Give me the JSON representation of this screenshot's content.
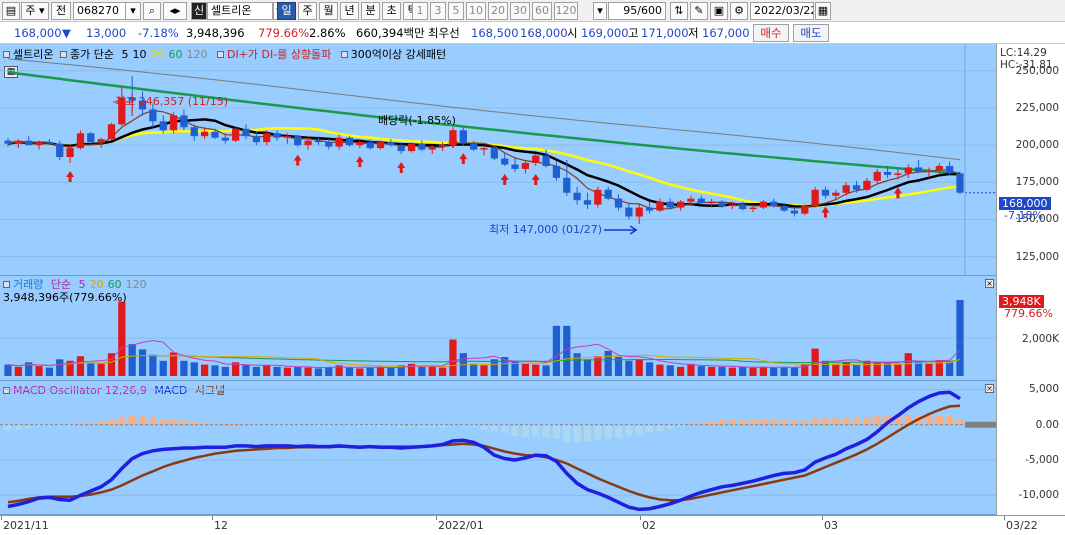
{
  "toolbar": {
    "mode": "주",
    "prev": "전",
    "code": "068270",
    "flag": "신",
    "name": "셀트리온",
    "periods": [
      "일",
      "주",
      "월",
      "년",
      "분",
      "초",
      "틱"
    ],
    "active_period": "일",
    "minutes": [
      "1",
      "3",
      "5",
      "10",
      "20",
      "30",
      "60",
      "120"
    ],
    "count": "95/600",
    "date": "2022/03/22"
  },
  "price_info": {
    "price": "168,000",
    "direction": "▼",
    "change": "13,000",
    "rate": "-7.18%",
    "volume": "3,948,396",
    "vol_ratio": "779.66%",
    "turnover_rate": "2.86%",
    "amount": "660,394백만",
    "best_label": "최우선",
    "best_ask": "168,500",
    "best_bid": "168,000",
    "open_label": "시",
    "open": "169,000",
    "high_label": "고",
    "high": "171,000",
    "low_label": "저",
    "low": "167,000",
    "buy": "매수",
    "sell": "매도"
  },
  "price_panel": {
    "legend_name": "셀트리온",
    "legend_close": "종가 단순",
    "ma_labels": [
      "5",
      "10",
      "20",
      "60",
      "120"
    ],
    "ma_colors": [
      "#000000",
      "#000000",
      "#ffff00",
      "#1a9a4a",
      "#888888"
    ],
    "signal": "DI+가 DI-를 상향돌파",
    "pattern": "300억이상 강세패턴",
    "lc": "LC:14.29",
    "hc": "HC:-31.81",
    "high_note": "최고 246,357 (11/15)",
    "low_note": "최저 147,000 (01/27)",
    "dividend_note": "배당락(-1.85%)",
    "y_ticks": [
      "250,000",
      "225,000",
      "200,000",
      "175,000",
      "150,000",
      "125,000"
    ],
    "current_price": "168,000",
    "current_rate": "-7.18%"
  },
  "volume_panel": {
    "legend": "거래량",
    "ma_label": "단순",
    "ma_periods": [
      "5",
      "20",
      "60",
      "120"
    ],
    "value_text": "3,948,396주(779.66%)",
    "y_ticks": [
      "2,000K"
    ],
    "badge": "3,948K",
    "badge_pct": "779.66%"
  },
  "macd_panel": {
    "legend": "MACD Oscillator 12,26,9",
    "macd": "MACD",
    "signal": "시그널",
    "y_ticks": [
      "5,000",
      "0.00",
      "-5,000",
      "-10,000"
    ]
  },
  "x_axis": {
    "labels": [
      "2021/11",
      "12",
      "2022/01",
      "02",
      "03",
      "03/22"
    ]
  },
  "chart_data": {
    "type": "candlestick",
    "title": "셀트리온",
    "ylim": [
      112000,
      268000
    ],
    "candles": [
      [
        203000,
        205000,
        199000,
        201000
      ],
      [
        201000,
        204000,
        198000,
        203000
      ],
      [
        203000,
        206000,
        200000,
        200000
      ],
      [
        200000,
        203000,
        197000,
        202000
      ],
      [
        202000,
        204000,
        200000,
        201000
      ],
      [
        201000,
        203000,
        190000,
        192000
      ],
      [
        192000,
        200000,
        188000,
        198000
      ],
      [
        198000,
        210000,
        197000,
        208000
      ],
      [
        208000,
        209000,
        200000,
        202000
      ],
      [
        202000,
        205000,
        198000,
        204000
      ],
      [
        204000,
        215000,
        203000,
        214000
      ],
      [
        214000,
        240000,
        213000,
        232000
      ],
      [
        232000,
        246357,
        222000,
        230000
      ],
      [
        230000,
        236000,
        220000,
        224000
      ],
      [
        224000,
        228000,
        212000,
        216000
      ],
      [
        216000,
        220000,
        208000,
        210000
      ],
      [
        210000,
        222000,
        208000,
        220000
      ],
      [
        220000,
        224000,
        210000,
        212000
      ],
      [
        212000,
        214000,
        203000,
        206000
      ],
      [
        206000,
        212000,
        204000,
        209000
      ],
      [
        209000,
        211000,
        204000,
        205000
      ],
      [
        205000,
        208000,
        201000,
        203000
      ],
      [
        203000,
        212000,
        202000,
        211000
      ],
      [
        211000,
        214000,
        204000,
        206000
      ],
      [
        206000,
        209000,
        200000,
        202000
      ],
      [
        202000,
        210000,
        200000,
        208000
      ],
      [
        208000,
        210000,
        203000,
        205000
      ],
      [
        205000,
        208000,
        201000,
        206000
      ],
      [
        206000,
        207000,
        199000,
        200000
      ],
      [
        200000,
        205000,
        197000,
        203000
      ],
      [
        203000,
        206000,
        200000,
        202000
      ],
      [
        202000,
        204000,
        197000,
        199000
      ],
      [
        199000,
        207000,
        197000,
        205000
      ],
      [
        205000,
        206000,
        199000,
        200000
      ],
      [
        200000,
        204000,
        198000,
        202000
      ],
      [
        202000,
        204000,
        197000,
        198000
      ],
      [
        198000,
        203000,
        197000,
        202000
      ],
      [
        202000,
        204000,
        199000,
        200000
      ],
      [
        200000,
        202000,
        194000,
        196000
      ],
      [
        196000,
        202000,
        195000,
        201000
      ],
      [
        201000,
        203000,
        196000,
        197000
      ],
      [
        197000,
        200000,
        194000,
        199000
      ],
      [
        199000,
        202000,
        196000,
        200000
      ],
      [
        200000,
        212000,
        199000,
        210000
      ],
      [
        210000,
        212000,
        200000,
        201000
      ],
      [
        201000,
        203000,
        196000,
        197000
      ],
      [
        197000,
        200000,
        193000,
        198000
      ],
      [
        198000,
        199000,
        190000,
        191000
      ],
      [
        191000,
        195000,
        186000,
        187000
      ],
      [
        187000,
        192000,
        182000,
        184000
      ],
      [
        184000,
        190000,
        181000,
        188000
      ],
      [
        188000,
        194000,
        186000,
        193000
      ],
      [
        193000,
        197000,
        185000,
        186000
      ],
      [
        186000,
        189000,
        176000,
        178000
      ],
      [
        178000,
        190000,
        166000,
        168000
      ],
      [
        168000,
        172000,
        160000,
        163000
      ],
      [
        163000,
        168000,
        157000,
        160000
      ],
      [
        160000,
        172000,
        158000,
        170000
      ],
      [
        170000,
        172000,
        163000,
        164000
      ],
      [
        164000,
        167000,
        156000,
        158000
      ],
      [
        158000,
        161000,
        150000,
        152000
      ],
      [
        152000,
        160000,
        147000,
        158000
      ],
      [
        158000,
        162000,
        154000,
        156000
      ],
      [
        156000,
        164000,
        155000,
        162000
      ],
      [
        162000,
        164000,
        157000,
        158000
      ],
      [
        158000,
        163000,
        156000,
        162000
      ],
      [
        162000,
        166000,
        159000,
        164000
      ],
      [
        164000,
        166000,
        160000,
        161000
      ],
      [
        161000,
        164000,
        158000,
        162000
      ],
      [
        162000,
        163000,
        158000,
        159000
      ],
      [
        159000,
        162000,
        157000,
        160000
      ],
      [
        160000,
        162000,
        156000,
        157000
      ],
      [
        157000,
        160000,
        155000,
        158000
      ],
      [
        158000,
        163000,
        157000,
        162000
      ],
      [
        162000,
        164000,
        158000,
        159000
      ],
      [
        159000,
        161000,
        155000,
        156000
      ],
      [
        156000,
        158000,
        152000,
        154000
      ],
      [
        154000,
        160000,
        153000,
        159000
      ],
      [
        159000,
        172000,
        158000,
        170000
      ],
      [
        170000,
        172000,
        164000,
        166000
      ],
      [
        166000,
        170000,
        163000,
        168000
      ],
      [
        168000,
        175000,
        166000,
        173000
      ],
      [
        173000,
        176000,
        168000,
        170000
      ],
      [
        170000,
        178000,
        169000,
        176000
      ],
      [
        176000,
        184000,
        174000,
        182000
      ],
      [
        182000,
        186000,
        178000,
        180000
      ],
      [
        180000,
        184000,
        177000,
        181000
      ],
      [
        181000,
        187000,
        178000,
        185000
      ],
      [
        185000,
        190000,
        181000,
        182000
      ],
      [
        182000,
        185000,
        178000,
        183000
      ],
      [
        183000,
        188000,
        180000,
        186000
      ],
      [
        186000,
        189000,
        180000,
        181000
      ],
      [
        181000,
        182000,
        167000,
        168000
      ]
    ],
    "volumes": [
      0.15,
      0.12,
      0.18,
      0.13,
      0.11,
      0.22,
      0.2,
      0.26,
      0.17,
      0.16,
      0.3,
      0.98,
      0.42,
      0.35,
      0.28,
      0.2,
      0.31,
      0.2,
      0.18,
      0.15,
      0.14,
      0.12,
      0.18,
      0.15,
      0.12,
      0.14,
      0.12,
      0.11,
      0.12,
      0.11,
      0.1,
      0.12,
      0.14,
      0.11,
      0.1,
      0.11,
      0.12,
      0.11,
      0.14,
      0.16,
      0.13,
      0.12,
      0.11,
      0.48,
      0.3,
      0.16,
      0.14,
      0.22,
      0.25,
      0.2,
      0.16,
      0.15,
      0.14,
      0.66,
      0.66,
      0.3,
      0.22,
      0.26,
      0.33,
      0.25,
      0.2,
      0.22,
      0.18,
      0.15,
      0.14,
      0.12,
      0.16,
      0.13,
      0.12,
      0.12,
      0.11,
      0.12,
      0.11,
      0.12,
      0.11,
      0.12,
      0.11,
      0.15,
      0.36,
      0.2,
      0.16,
      0.18,
      0.15,
      0.2,
      0.19,
      0.17,
      0.15,
      0.3,
      0.18,
      0.16,
      0.21,
      0.18,
      1.0
    ],
    "macd_osc": [
      -800,
      -700,
      -500,
      -200,
      -100,
      -250,
      -300,
      100,
      300,
      400,
      700,
      1100,
      1300,
      1200,
      1000,
      700,
      800,
      600,
      400,
      300,
      200,
      100,
      150,
      50,
      -100,
      -50,
      -100,
      -150,
      -200,
      -150,
      -200,
      -250,
      -200,
      -250,
      -300,
      -250,
      -300,
      -300,
      -400,
      -350,
      -400,
      -450,
      -400,
      -100,
      -200,
      -400,
      -700,
      -900,
      -1200,
      -1600,
      -1800,
      -1700,
      -1800,
      -2000,
      -2400,
      -2500,
      -2400,
      -2100,
      -2000,
      -1900,
      -1700,
      -1400,
      -1100,
      -900,
      -600,
      -300,
      100,
      300,
      500,
      700,
      700,
      700,
      700,
      800,
      800,
      700,
      600,
      600,
      900,
      900,
      900,
      1000,
      1000,
      1100,
      1200,
      1200,
      1300,
      1400,
      1300,
      1300,
      1300,
      1200,
      700
    ],
    "macd_line": [
      -11600,
      -11300,
      -10900,
      -10400,
      -10300,
      -10600,
      -10700,
      -10000,
      -9400,
      -8800,
      -7800,
      -6200,
      -4800,
      -4100,
      -3700,
      -3500,
      -3400,
      -3300,
      -3300,
      -3200,
      -3200,
      -3200,
      -3000,
      -3000,
      -3100,
      -3000,
      -3000,
      -3000,
      -3100,
      -3000,
      -3100,
      -3100,
      -3000,
      -3100,
      -3200,
      -3100,
      -3200,
      -3200,
      -3300,
      -3200,
      -3100,
      -3000,
      -2800,
      -2300,
      -2200,
      -2500,
      -3200,
      -4300,
      -4800,
      -5000,
      -4700,
      -4300,
      -4400,
      -5200,
      -6900,
      -8300,
      -9200,
      -9700,
      -10300,
      -11000,
      -11700,
      -12000,
      -11900,
      -11600,
      -11200,
      -10700,
      -10100,
      -9600,
      -9200,
      -8800,
      -8600,
      -8300,
      -8000,
      -7600,
      -7200,
      -6900,
      -6800,
      -6400,
      -5300,
      -4700,
      -4200,
      -3400,
      -2800,
      -2100,
      -1000,
      300,
      1300,
      2400,
      3300,
      4000,
      4500,
      4600,
      3700
    ],
    "signal_line": [
      -11000,
      -10800,
      -10500,
      -10300,
      -10200,
      -10200,
      -10200,
      -10100,
      -9900,
      -9600,
      -9200,
      -8600,
      -7900,
      -7200,
      -6600,
      -6000,
      -5500,
      -5100,
      -4700,
      -4400,
      -4100,
      -3900,
      -3700,
      -3600,
      -3500,
      -3400,
      -3300,
      -3300,
      -3200,
      -3200,
      -3200,
      -3200,
      -3100,
      -3100,
      -3100,
      -3100,
      -3100,
      -3100,
      -3100,
      -3100,
      -3100,
      -3000,
      -2900,
      -2800,
      -2700,
      -2800,
      -3000,
      -3400,
      -3800,
      -4100,
      -4300,
      -4400,
      -4600,
      -5000,
      -5500,
      -6200,
      -6900,
      -7600,
      -8200,
      -8800,
      -9400,
      -9900,
      -10300,
      -10600,
      -10700,
      -10700,
      -10500,
      -10200,
      -9900,
      -9600,
      -9300,
      -9000,
      -8700,
      -8400,
      -8100,
      -7800,
      -7500,
      -7200,
      -6600,
      -6000,
      -5400,
      -4800,
      -4200,
      -3500,
      -2700,
      -1800,
      -900,
      0,
      800,
      1500,
      2100,
      2600,
      2700
    ]
  }
}
